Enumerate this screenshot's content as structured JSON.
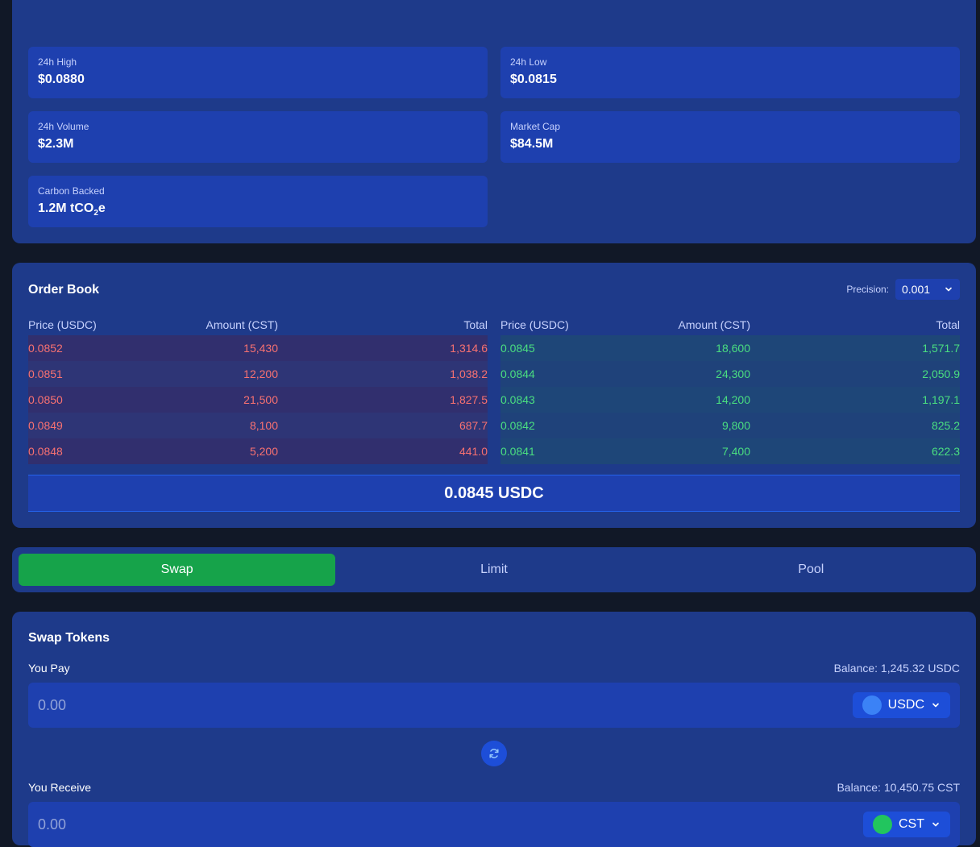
{
  "stats": {
    "high": {
      "label": "24h High",
      "value": "$0.0880"
    },
    "low": {
      "label": "24h Low",
      "value": "$0.0815"
    },
    "volume": {
      "label": "24h Volume",
      "value": "$2.3M"
    },
    "market_cap": {
      "label": "Market Cap",
      "value": "$84.5M"
    },
    "carbon": {
      "label": "Carbon Backed",
      "value_prefix": "1.2M tCO",
      "value_sub": "2",
      "value_suffix": "e"
    }
  },
  "order_book": {
    "title": "Order Book",
    "precision_label": "Precision:",
    "precision_value": "0.001",
    "headers": {
      "price": "Price (USDC)",
      "amount": "Amount (CST)",
      "total": "Total"
    },
    "asks": [
      {
        "price": "0.0852",
        "amount": "15,430",
        "total": "1,314.6"
      },
      {
        "price": "0.0851",
        "amount": "12,200",
        "total": "1,038.2"
      },
      {
        "price": "0.0850",
        "amount": "21,500",
        "total": "1,827.5"
      },
      {
        "price": "0.0849",
        "amount": "8,100",
        "total": "687.7"
      },
      {
        "price": "0.0848",
        "amount": "5,200",
        "total": "441.0"
      }
    ],
    "bids": [
      {
        "price": "0.0845",
        "amount": "18,600",
        "total": "1,571.7"
      },
      {
        "price": "0.0844",
        "amount": "24,300",
        "total": "2,050.9"
      },
      {
        "price": "0.0843",
        "amount": "14,200",
        "total": "1,197.1"
      },
      {
        "price": "0.0842",
        "amount": "9,800",
        "total": "825.2"
      },
      {
        "price": "0.0841",
        "amount": "7,400",
        "total": "622.3"
      }
    ],
    "mid_price": "0.0845 USDC"
  },
  "tabs": [
    {
      "label": "Swap",
      "active": true
    },
    {
      "label": "Limit",
      "active": false
    },
    {
      "label": "Pool",
      "active": false
    }
  ],
  "swap": {
    "title": "Swap Tokens",
    "pay": {
      "label": "You Pay",
      "balance": "Balance: 1,245.32 USDC",
      "placeholder": "0.00",
      "token": "USDC",
      "token_color": "#3b82f6"
    },
    "receive": {
      "label": "You Receive",
      "balance": "Balance: 10,450.75 CST",
      "placeholder": "0.00",
      "token": "CST",
      "token_color": "#22c55e"
    },
    "swap_icon": "refresh-icon"
  },
  "colors": {
    "ask": "#f87171",
    "bid": "#4ade80",
    "accent": "#16a34a"
  }
}
